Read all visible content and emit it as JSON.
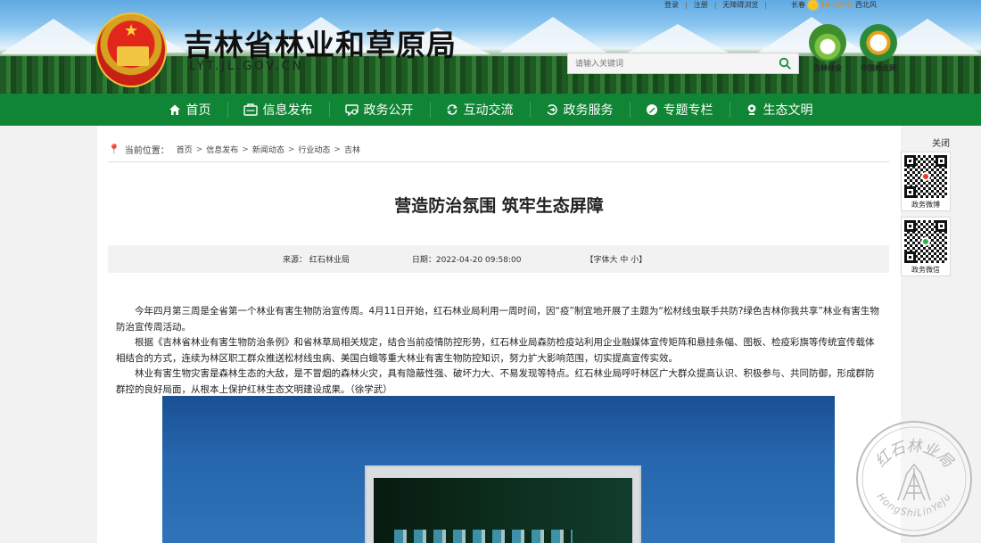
{
  "header": {
    "site_title": "吉林省林业和草原局",
    "site_domain": "LYT.JL.GOV.CN",
    "top_links": [
      "登录",
      "注册",
      "无障碍浏览"
    ],
    "weather": {
      "city": "长春",
      "temp": "16~25℃",
      "wind": "西北风"
    },
    "search_placeholder": "请输入关键词",
    "logos": [
      {
        "name": "吉林林业",
        "color": "#3d8f2e"
      },
      {
        "name": "中国林业网",
        "color": "#2a8a3a"
      }
    ]
  },
  "nav": {
    "items": [
      {
        "label": "首页",
        "icon": "home-icon"
      },
      {
        "label": "信息发布",
        "icon": "info-release-icon"
      },
      {
        "label": "政务公开",
        "icon": "gov-open-icon"
      },
      {
        "label": "互动交流",
        "icon": "interaction-icon"
      },
      {
        "label": "政务服务",
        "icon": "gov-service-icon"
      },
      {
        "label": "专题专栏",
        "icon": "topic-icon"
      },
      {
        "label": "生态文明",
        "icon": "ecology-icon"
      }
    ],
    "bg_color": "#0f8535"
  },
  "breadcrumb": {
    "label": "当前位置：",
    "items": [
      "首页",
      "信息发布",
      "新闻动态",
      "行业动态",
      "吉林"
    ]
  },
  "article": {
    "title": "营造防治氛围 筑牢生态屏障",
    "source": "来源： 红石林业局",
    "date": "日期：2022-04-20 09:58:00",
    "font_size_control": "【字体大 中 小】",
    "paragraphs": [
      "今年四月第三周是全省第一个林业有害生物防治宣传周。4月11日开始，红石林业局利用一周时间，因“疫”制宜地开展了主题为“松材线虫联手共防?绿色吉林你我共享”林业有害生物防治宣传周活动。",
      "根据《吉林省林业有害生物防治条例》和省林草局相关规定，结合当前疫情防控形势，红石林业局森防检疫站利用企业融媒体宣传矩阵和悬挂条幅、图板、检疫彩旗等传统宣传载体相结合的方式，连续为林区职工群众推送松材线虫病、美国白蛾等重大林业有害生物防控知识，努力扩大影响范围，切实提高宣传实效。",
      "林业有害生物灾害是森林生态的大敌，是不冒烟的森林火灾，具有隐蔽性强、破坏力大、不易发现等特点。红石林业局呼吁林区广大群众提高认识、积极参与、共同防御，形成群防群控的良好局面，从根本上保护红林生态文明建设成果。（徐学武）"
    ]
  },
  "side_panel": {
    "close_label": "关闭",
    "qr_items": [
      {
        "caption": "政务微博"
      },
      {
        "caption": "政务微信"
      }
    ]
  },
  "watermark": {
    "text_top": "红石林业局",
    "text_bottom": "HongShiLinYeJu"
  }
}
